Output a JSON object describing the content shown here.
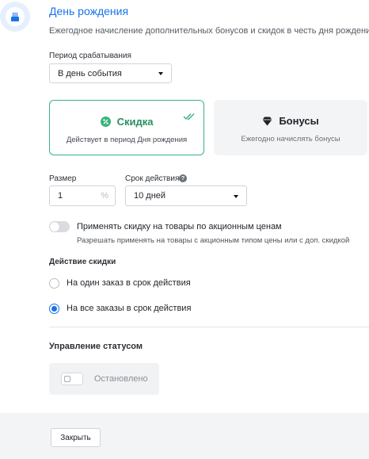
{
  "header": {
    "icon": "birthday-cake-icon",
    "title": "День рождения",
    "subtitle": "Ежегодное начисление дополнительных бонусов и скидок в честь дня рождения"
  },
  "trigger_period": {
    "label": "Период срабатывания",
    "value": "В день события"
  },
  "options": {
    "discount": {
      "icon": "percent-icon",
      "title": "Скидка",
      "description": "Действует в период Дня рождения",
      "selected": true,
      "accent_color": "#37b37e"
    },
    "bonus": {
      "icon": "diamond-icon",
      "title": "Бонусы",
      "description": "Ежегодно начислять бонусы",
      "selected": false
    }
  },
  "size": {
    "label": "Размер",
    "value": "1",
    "unit": "%"
  },
  "validity": {
    "label": "Срок действия",
    "help": "?",
    "value": "10 дней"
  },
  "promo_toggle": {
    "label": "Применять скидку на товары по акционным ценам",
    "description": "Разрешать применять на товары с акционным типом цены или с доп. скидкой",
    "enabled": false
  },
  "discount_action": {
    "label": "Действие скидки",
    "options": [
      {
        "label": "На один заказ в срок действия",
        "checked": false
      },
      {
        "label": "На все заказы в срок действия",
        "checked": true
      }
    ]
  },
  "status": {
    "heading": "Управление статусом",
    "label": "Остановлено"
  },
  "footer": {
    "close_label": "Закрыть"
  },
  "colors": {
    "primary": "#1a73e8",
    "success": "#37b37e"
  }
}
